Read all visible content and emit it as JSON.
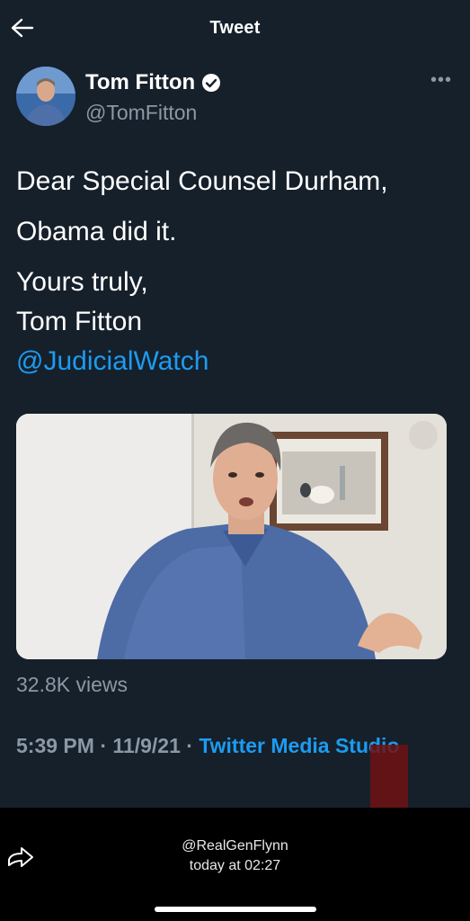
{
  "header": {
    "title": "Tweet"
  },
  "author": {
    "name": "Tom Fitton",
    "handle": "@TomFitton",
    "verified": true
  },
  "tweet": {
    "line1": "Dear Special Counsel Durham,",
    "line2": "Obama did it.",
    "line3": "Yours truly,",
    "line4": "Tom Fitton",
    "mention": "@JudicialWatch"
  },
  "stats": {
    "views": "32.8K views"
  },
  "meta": {
    "time": "5:39 PM",
    "sep1": " · ",
    "date": "11/9/21",
    "sep2": " · ",
    "source": "Twitter Media Studio"
  },
  "share": {
    "username": "@RealGenFlynn",
    "time": "today at 02:27"
  },
  "colors": {
    "background": "#15202b",
    "link": "#1d9bf0",
    "secondary_text": "#8b98a5"
  }
}
